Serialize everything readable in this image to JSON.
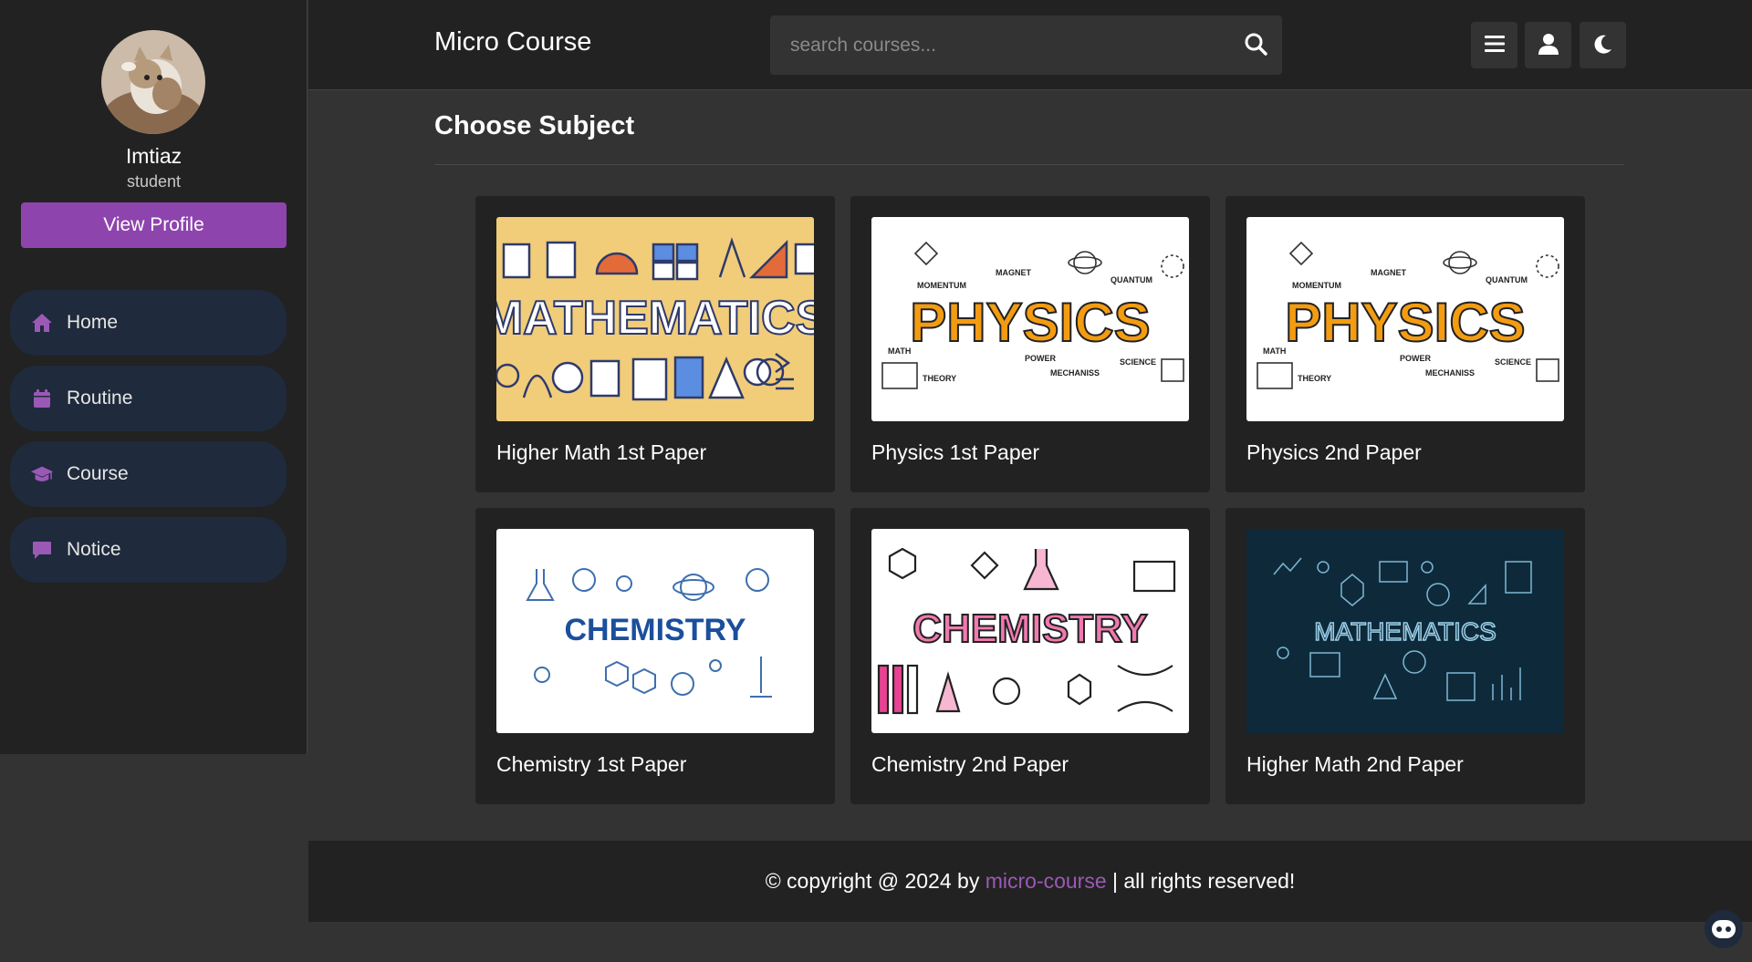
{
  "sidebar": {
    "profile": {
      "name": "Imtiaz",
      "role": "student",
      "button": "View Profile"
    },
    "items": [
      {
        "label": "Home",
        "icon": "home-icon"
      },
      {
        "label": "Routine",
        "icon": "calendar-icon"
      },
      {
        "label": "Course",
        "icon": "graduation-cap-icon"
      },
      {
        "label": "Notice",
        "icon": "comment-icon"
      }
    ]
  },
  "header": {
    "brand": "Micro Course",
    "search_placeholder": "search courses...",
    "buttons": [
      "menu-icon",
      "user-icon",
      "moon-icon"
    ]
  },
  "main": {
    "title": "Choose Subject",
    "courses": [
      {
        "title": "Higher Math 1st Paper",
        "image_text": "MATHEMATICS"
      },
      {
        "title": "Physics 1st Paper",
        "image_text": "PHYSICS",
        "image_labels": [
          "MOMENTUM",
          "MAGNET",
          "QUANTUM",
          "MATH",
          "THEORY",
          "POWER",
          "MECHANISS",
          "SCIENCE"
        ]
      },
      {
        "title": "Physics 2nd Paper",
        "image_text": "PHYSICS",
        "image_labels": [
          "MOMENTUM",
          "MAGNET",
          "QUANTUM",
          "MATH",
          "THEORY",
          "POWER",
          "MECHANISS",
          "SCIENCE"
        ]
      },
      {
        "title": "Chemistry 1st Paper",
        "image_text": "CHEMISTRY"
      },
      {
        "title": "Chemistry 2nd Paper",
        "image_text": "CHEMISTRY"
      },
      {
        "title": "Higher Math 2nd Paper",
        "image_text": "MATHEMATICS"
      }
    ]
  },
  "footer": {
    "prefix": "© copyright @ 2024 by ",
    "link": "micro-course",
    "suffix": " | all rights reserved!"
  },
  "colors": {
    "accent": "#8e44ad",
    "link": "#9b59b6",
    "nav_bg": "#1f2a3c",
    "panel_bg": "#222222",
    "page_bg": "#333333"
  }
}
